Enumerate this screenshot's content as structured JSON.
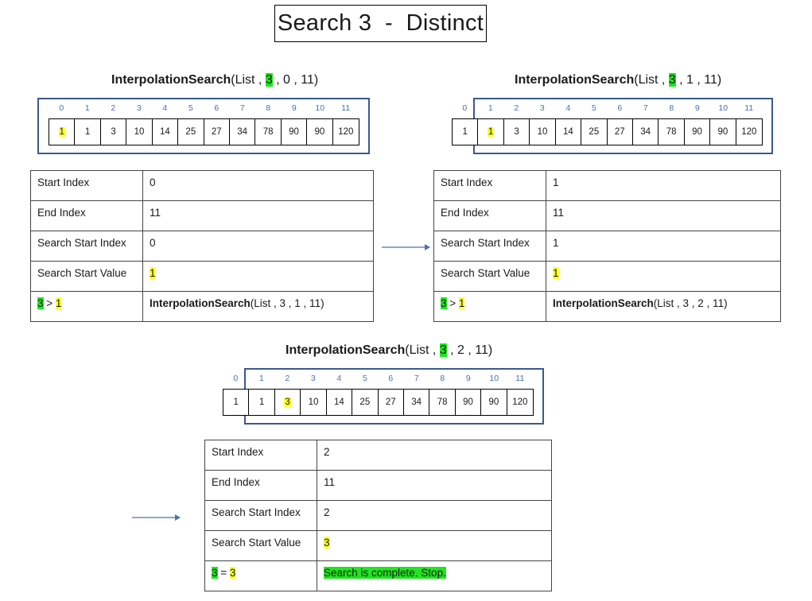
{
  "title": "Search 3  -  Distinct",
  "steps": [
    {
      "call": {
        "fn": "InterpolationSearch",
        "open": "(List , ",
        "target": "3",
        "rest": " , 0 , 11)"
      },
      "indices": [
        "0",
        "1",
        "2",
        "3",
        "4",
        "5",
        "6",
        "7",
        "8",
        "9",
        "10",
        "11"
      ],
      "values": [
        "1",
        "1",
        "3",
        "10",
        "14",
        "25",
        "27",
        "34",
        "78",
        "90",
        "90",
        "120"
      ],
      "highlight_cell": 0,
      "rows": [
        {
          "key": "Start Index",
          "value": "0"
        },
        {
          "key": "End Index",
          "value": "11"
        },
        {
          "key": "Search Start Index",
          "value": "0"
        },
        {
          "key": "Search Start Value",
          "value": "1"
        }
      ],
      "cmp": {
        "left": "3",
        "op": " > ",
        "right": "1"
      },
      "result": {
        "fn": "InterpolationSearch",
        "args": "(List , 3 , 1 , 11)"
      }
    },
    {
      "call": {
        "fn": "InterpolationSearch",
        "open": "(List , ",
        "target": "3",
        "rest": " , 1 , 11)"
      },
      "indices": [
        "0",
        "1",
        "2",
        "3",
        "4",
        "5",
        "6",
        "7",
        "8",
        "9",
        "10",
        "11"
      ],
      "values": [
        "1",
        "1",
        "3",
        "10",
        "14",
        "25",
        "27",
        "34",
        "78",
        "90",
        "90",
        "120"
      ],
      "highlight_cell": 1,
      "rows": [
        {
          "key": "Start Index",
          "value": "1"
        },
        {
          "key": "End Index",
          "value": "11"
        },
        {
          "key": "Search Start Index",
          "value": "1"
        },
        {
          "key": "Search Start Value",
          "value": "1"
        }
      ],
      "cmp": {
        "left": "3",
        "op": " > ",
        "right": "1"
      },
      "result": {
        "fn": "InterpolationSearch",
        "args": "(List , 3 , 2 , 11)"
      }
    },
    {
      "call": {
        "fn": "InterpolationSearch",
        "open": "(List , ",
        "target": "3",
        "rest": " , 2 , 11)"
      },
      "indices": [
        "0",
        "1",
        "2",
        "3",
        "4",
        "5",
        "6",
        "7",
        "8",
        "9",
        "10",
        "11"
      ],
      "values": [
        "1",
        "1",
        "3",
        "10",
        "14",
        "25",
        "27",
        "34",
        "78",
        "90",
        "90",
        "120"
      ],
      "highlight_cell": 2,
      "rows": [
        {
          "key": "Start Index",
          "value": "2"
        },
        {
          "key": "End Index",
          "value": "11"
        },
        {
          "key": "Search Start Index",
          "value": "2"
        },
        {
          "key": "Search Start Value",
          "value": "3"
        }
      ],
      "cmp": {
        "left": "3",
        "op": " = ",
        "right": "3"
      },
      "result_text": "Search is complete. Stop."
    }
  ],
  "colors": {
    "target_highlight": "#1fe61f",
    "value_highlight": "#ffff33",
    "range_border": "#3a5a8c",
    "arrow": "#4a72b8"
  }
}
